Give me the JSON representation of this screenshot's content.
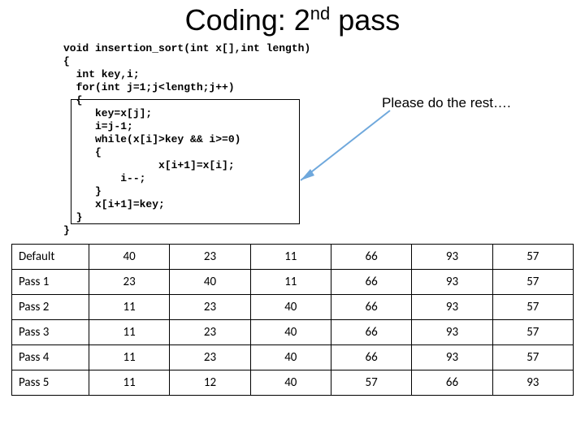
{
  "title_prefix": "Coding: 2",
  "title_sup": "nd",
  "title_suffix": " pass",
  "code": {
    "l0": "void insertion_sort(int x[],int length)",
    "l1": "{",
    "l2": "  int key,i;",
    "l3": "  for(int j=1;j<length;j++)",
    "l4": "  {",
    "l5": "     key=x[j];",
    "l6": "     i=j-1;",
    "l7": "     while(x[i]>key && i>=0)",
    "l8": "     {",
    "l9": "               x[i+1]=x[i];",
    "l10": "         i--;",
    "l11": "     }",
    "l12": "     x[i+1]=key;",
    "l13": "  }",
    "l14": "}"
  },
  "annotation": "Please do the rest….",
  "table": {
    "rows": [
      {
        "label": "Default",
        "cells": [
          "40",
          "23",
          "11",
          "66",
          "93",
          "57"
        ]
      },
      {
        "label": "Pass 1",
        "cells": [
          "23",
          "40",
          "11",
          "66",
          "93",
          "57"
        ]
      },
      {
        "label": "Pass 2",
        "cells": [
          "11",
          "23",
          "40",
          "66",
          "93",
          "57"
        ]
      },
      {
        "label": "Pass 3",
        "cells": [
          "11",
          "23",
          "40",
          "66",
          "93",
          "57"
        ]
      },
      {
        "label": "Pass 4",
        "cells": [
          "11",
          "23",
          "40",
          "66",
          "93",
          "57"
        ]
      },
      {
        "label": "Pass 5",
        "cells": [
          "11",
          "12",
          "40",
          "57",
          "66",
          "93"
        ]
      }
    ]
  },
  "chart_data": {
    "type": "table",
    "title": "Insertion sort passes",
    "columns": [
      "label",
      "v1",
      "v2",
      "v3",
      "v4",
      "v5",
      "v6"
    ],
    "rows": [
      [
        "Default",
        40,
        23,
        11,
        66,
        93,
        57
      ],
      [
        "Pass 1",
        23,
        40,
        11,
        66,
        93,
        57
      ],
      [
        "Pass 2",
        11,
        23,
        40,
        66,
        93,
        57
      ],
      [
        "Pass 3",
        11,
        23,
        40,
        66,
        93,
        57
      ],
      [
        "Pass 4",
        11,
        23,
        40,
        66,
        93,
        57
      ],
      [
        "Pass 5",
        11,
        12,
        40,
        57,
        66,
        93
      ]
    ]
  }
}
